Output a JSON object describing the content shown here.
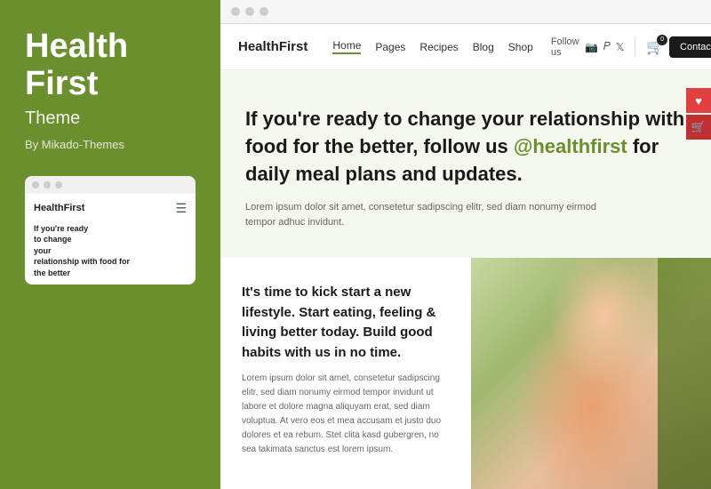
{
  "sidebar": {
    "title_line1": "Health",
    "title_line2": "First",
    "subtitle": "Theme",
    "by": "By Mikado-Themes",
    "mini_browser": {
      "logo": "HealthFirst",
      "hero_line1": "If you're ready",
      "hero_line2": "to change",
      "hero_line3": "your",
      "hero_line4": "relationship with food for",
      "hero_line5": "the better"
    }
  },
  "browser": {
    "dots": [
      "dot1",
      "dot2",
      "dot3"
    ]
  },
  "nav": {
    "logo": "HealthFirst",
    "links": [
      {
        "label": "Home",
        "active": true
      },
      {
        "label": "Pages",
        "active": false
      },
      {
        "label": "Recipes",
        "active": false
      },
      {
        "label": "Blog",
        "active": false
      },
      {
        "label": "Shop",
        "active": false
      }
    ],
    "follow_label": "Follow us",
    "contact_label": "Contact us"
  },
  "hero": {
    "text_before": "If you're ready to change your relationship with food for the better, follow us ",
    "handle": "@healthfirst",
    "text_after": " for daily meal plans and updates.",
    "sub_text": "Lorem ipsum dolor sit amet, consetetur sadipscing elitr, sed diam nonumy eirmod tempor adhuc invidunt."
  },
  "content": {
    "heading": "It's time to kick start a new lifestyle. Start eating, feeling & living better today. Build good habits with us in no time.",
    "body": "Lorem ipsum dolor sit amet, consetetur sadipscing elitr, sed diam nonumy eirmod tempor invidunt ut labore et dolore magna aliquyam erat, sed diam voluptua. At vero eos et mea accusam et justo duo dolores et ea rebum. Stet clita kasd gubergren, no sea takimata sanctus est lorem ipsum."
  }
}
